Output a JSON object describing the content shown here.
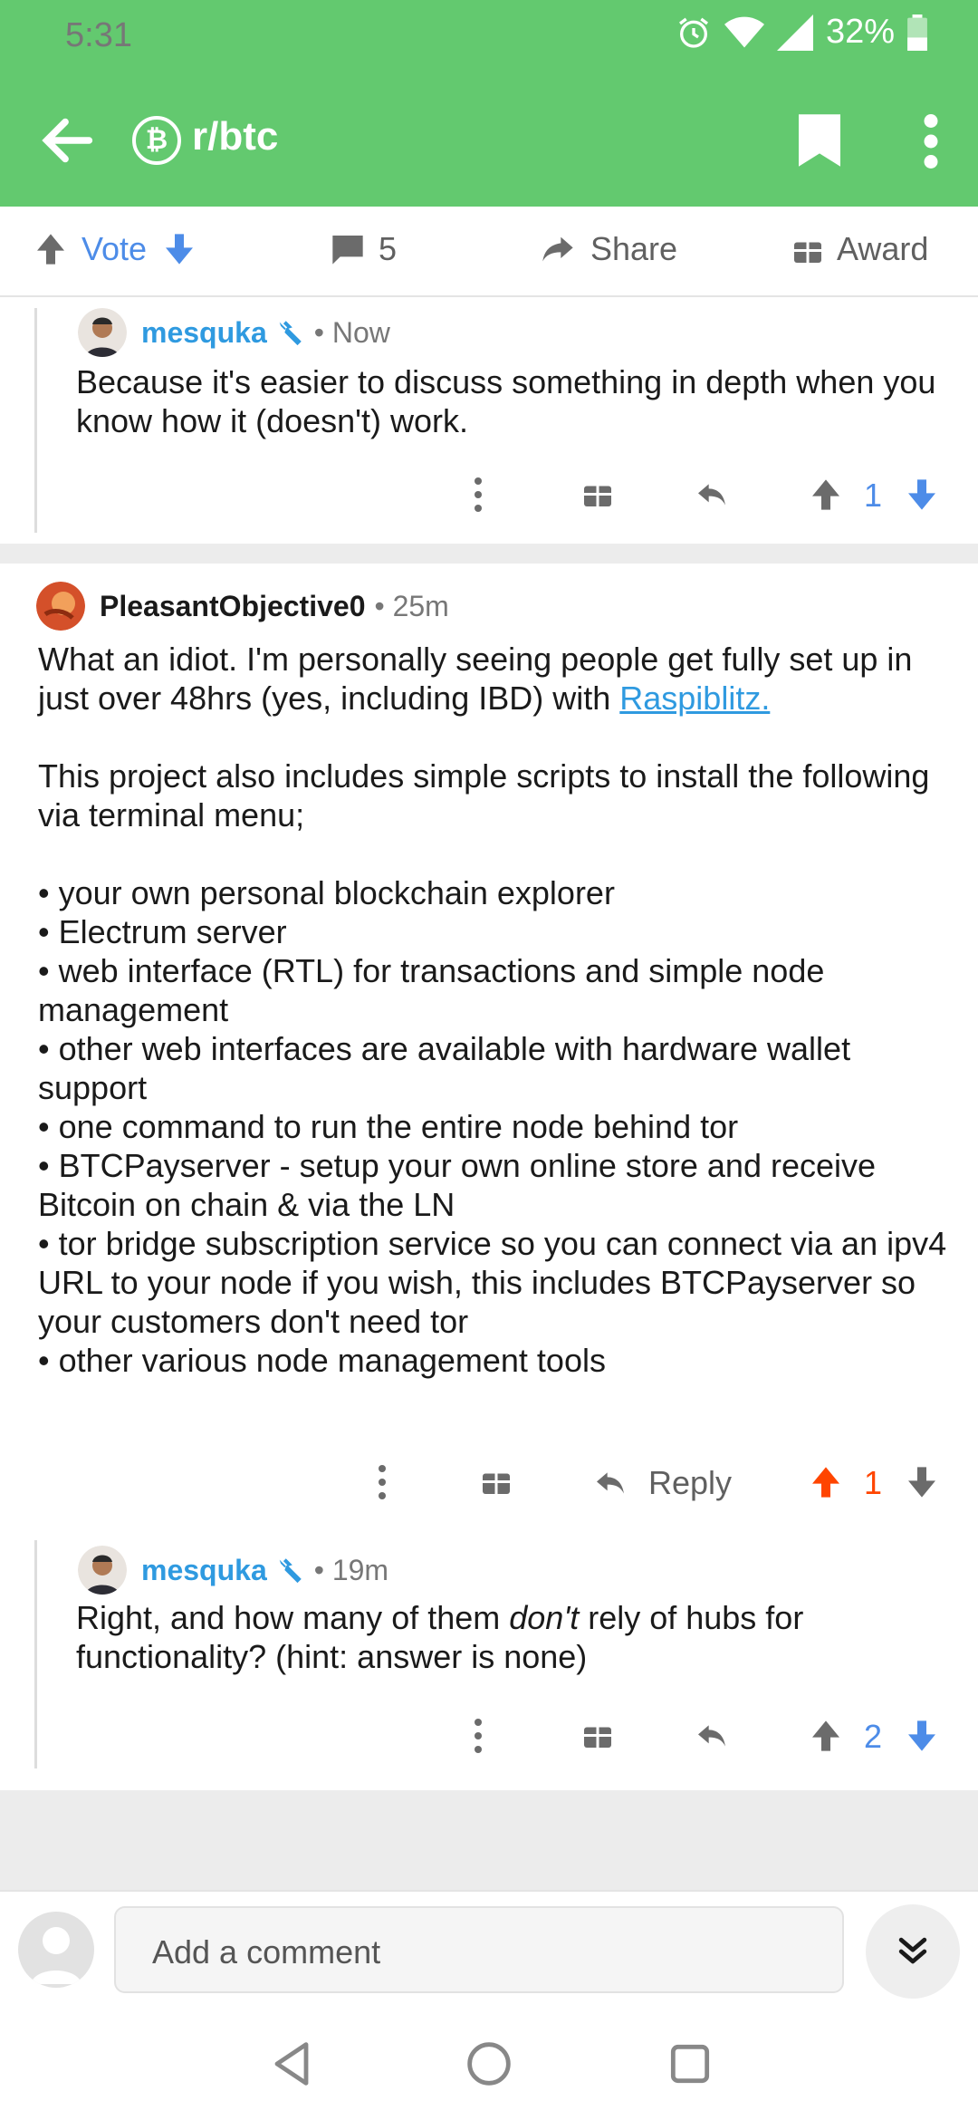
{
  "status": {
    "time": "5:31",
    "battery": "32%"
  },
  "header": {
    "subreddit": "r/btc",
    "subreddit_icon": "bitcoin-icon",
    "color": "#63c96f"
  },
  "actions": {
    "vote": "Vote",
    "comments": "5",
    "share": "Share",
    "award": "Award"
  },
  "comments": [
    {
      "author": "mesquka",
      "time": "Now",
      "body": "Because it's easier to discuss something in depth when you know how it (doesn't) work.",
      "score": "1"
    },
    {
      "author": "PleasantObjective0",
      "time": "25m",
      "body_p1_pre": "What an idiot.  I'm personally seeing people get fully set up in just over 48hrs (yes, including IBD) with ",
      "body_p1_link": "Raspiblitz.",
      "body_p2": "This project also includes simple scripts to install the following via terminal menu;",
      "bullets": [
        "• your own personal blockchain explorer",
        "• Electrum server",
        "• web interface (RTL) for transactions and simple node management",
        "• other web interfaces are available with hardware wallet support",
        "• one command to run the entire node behind tor",
        "• BTCPayserver - setup your own online store and receive Bitcoin on chain & via the LN",
        "• tor bridge subscription service so you can connect via an ipv4 URL to your node if you wish, this includes BTCPayserver so your customers don't need tor",
        "• other various node management tools"
      ],
      "reply_label": "Reply",
      "score": "1"
    },
    {
      "author": "mesquka",
      "time": "19m",
      "body_pre": "Right, and how many of them ",
      "body_em": "don't",
      "body_post": " rely of hubs for functionality? (hint: answer is none)",
      "score": "2"
    }
  ],
  "composer": {
    "placeholder": "Add a comment"
  },
  "colors": {
    "upvoted": "#ff4500",
    "blue": "#4d8ce8",
    "link": "#2f9ae0"
  }
}
